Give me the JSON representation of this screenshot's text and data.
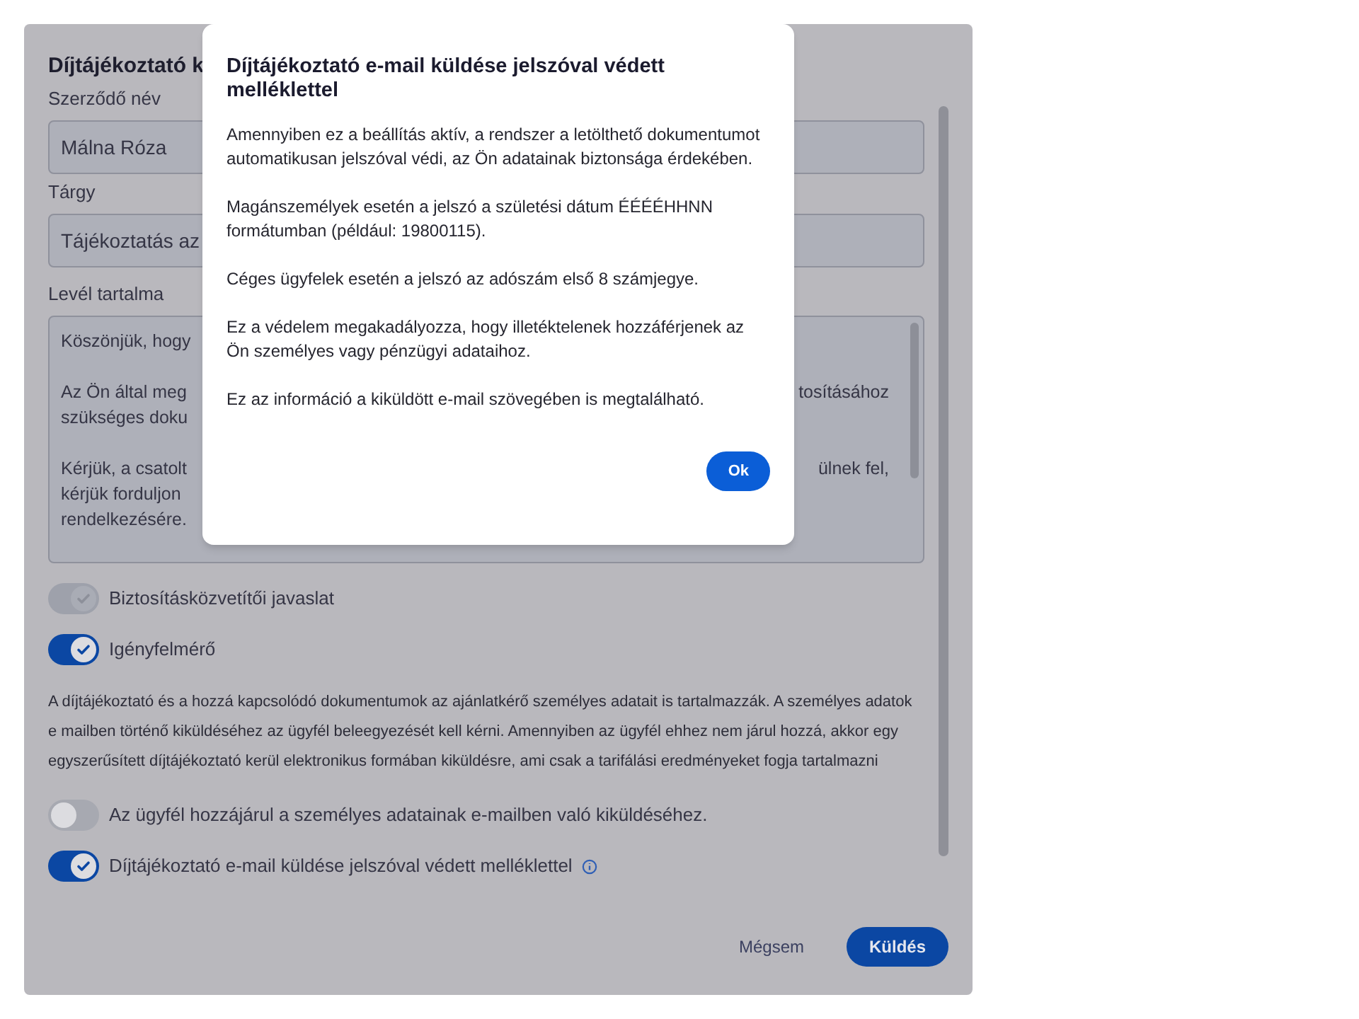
{
  "dialog": {
    "title": "Díjtájékoztató k",
    "fields": [
      {
        "label": "Szerződő név",
        "value": "Málna Róza"
      },
      {
        "label": "Tárgy",
        "value": "Tájékoztatás az"
      }
    ],
    "message": {
      "label": "Levél tartalma",
      "paragraphs": [
        [
          {
            "left": "Köszönjük, hogy"
          }
        ],
        [
          {
            "left": "Az Ön által meg",
            "right": "tosításához"
          },
          {
            "left": "szükséges doku"
          }
        ],
        [
          {
            "left": "Kérjük, a csatolt",
            "right": "ülnek fel,"
          },
          {
            "left": "kérjük forduljon"
          },
          {
            "left": "rendelkezésére."
          }
        ]
      ]
    },
    "options": [
      {
        "kind": "toggle",
        "label": "Biztosításközvetítői javaslat",
        "on": true,
        "disabled": true
      },
      {
        "kind": "toggle",
        "label": "Igényfelmérő",
        "on": true,
        "disabled": false
      },
      {
        "kind": "notice",
        "text": "A díjtájékoztató és a hozzá kapcsolódó dokumentumok az ajánlatkérő személyes adatait is tartalmazzák. A személyes adatok e mailben történő kiküldéséhez az ügyfél beleegyezését kell kérni. Amennyiben az ügyfél ehhez nem járul hozzá, akkor egy egyszerűsített díjtájékoztató kerül elektronikus formában kiküldésre, ami csak a tarifálási eredményeket fogja tartalmazni"
      },
      {
        "kind": "toggle",
        "label": "Az ügyfél hozzájárul a személyes adatainak e-mailben való kiküldéséhez.",
        "on": false,
        "disabled": false
      },
      {
        "kind": "toggle",
        "label": "Díjtájékoztató e-mail küldése jelszóval védett melléklettel",
        "on": true,
        "disabled": false,
        "info": true
      }
    ],
    "cancel": "Mégsem",
    "send": "Küldés"
  },
  "modal": {
    "title": "Díjtájékoztató e-mail küldése jelszóval védett melléklettel",
    "paragraphs": [
      "Amennyiben ez a beállítás aktív, a rendszer a letölthető dokumentumot automatikusan jelszóval védi, az Ön adatainak biztonsága érdekében.",
      "Magánszemélyek esetén a jelszó a születési dátum ÉÉÉÉHHNN formátumban (például: 19800115).",
      "Céges ügyfelek esetén a jelszó az adószám első 8 számjegye.",
      "Ez a védelem megakadályozza, hogy illetéktelenek hozzáférjenek az Ön személyes vagy pénzügyi adataihoz.",
      "Ez az információ a kiküldött e-mail szövegében is megtalálható."
    ],
    "ok": "Ok"
  }
}
